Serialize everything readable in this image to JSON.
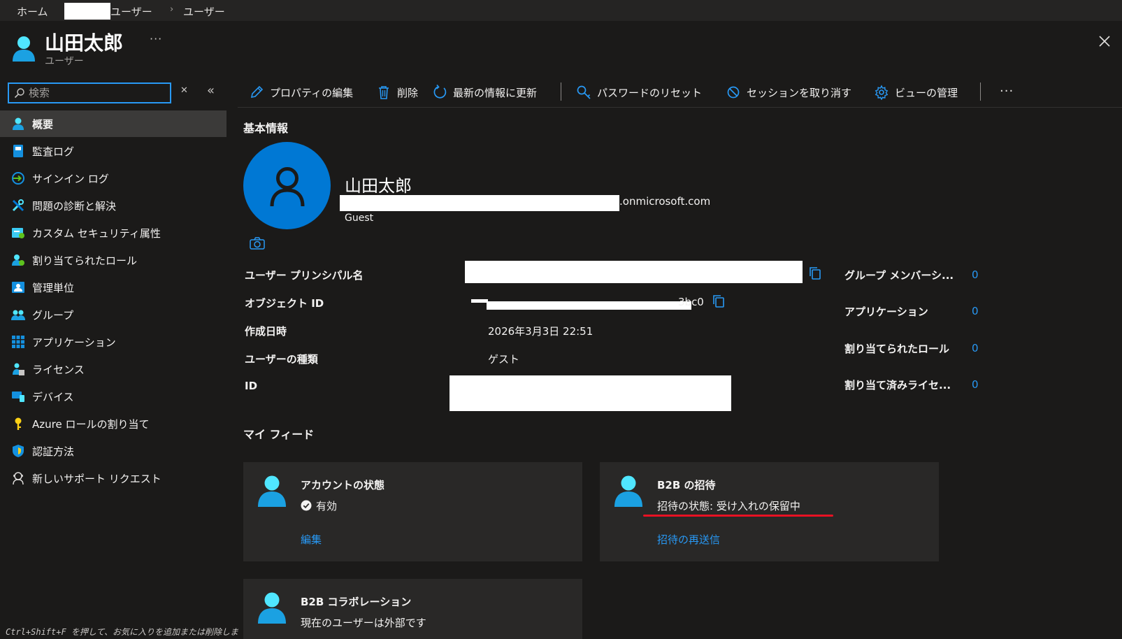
{
  "breadcrumb": {
    "home": "ホーム",
    "item_2": "ユーザー",
    "item_3": "ユーザー"
  },
  "header": {
    "title": "山田太郎",
    "subtitle": "ユーザー",
    "more": "···",
    "close": "✕"
  },
  "sidebar": {
    "search_placeholder": "検索",
    "clear": "✕",
    "collapse": "«",
    "items": [
      {
        "label": "概要",
        "icon": "user-icon",
        "active": true
      },
      {
        "label": "監査ログ",
        "icon": "audit-log-icon"
      },
      {
        "label": "サインイン ログ",
        "icon": "sign-in-icon"
      },
      {
        "label": "問題の診断と解決",
        "icon": "tools-icon"
      },
      {
        "label": "カスタム セキュリティ属性",
        "icon": "security-attributes-icon"
      },
      {
        "label": "割り当てられたロール",
        "icon": "roles-icon"
      },
      {
        "label": "管理単位",
        "icon": "admin-units-icon"
      },
      {
        "label": "グループ",
        "icon": "group-icon"
      },
      {
        "label": "アプリケーション",
        "icon": "applications-icon"
      },
      {
        "label": "ライセンス",
        "icon": "license-icon"
      },
      {
        "label": "デバイス",
        "icon": "devices-icon"
      },
      {
        "label": "Azure ロールの割り当て",
        "icon": "key-icon"
      },
      {
        "label": "認証方法",
        "icon": "shield-icon"
      },
      {
        "label": "新しいサポート リクエスト",
        "icon": "support-icon"
      }
    ],
    "shortcut_hint": "Ctrl+Shift+F を押して、お気に入りを追加または削除しま"
  },
  "toolbar": {
    "edit_properties": "プロパティの編集",
    "delete": "削除",
    "refresh": "最新の情報に更新",
    "reset_password": "パスワードのリセット",
    "revoke_sessions": "セッションを取り消す",
    "manage_view": "ビューの管理",
    "more": "···"
  },
  "basic_info": {
    "section_title": "基本情報",
    "display_name": "山田太郎",
    "email_suffix": ".onmicrosoft.com",
    "user_type_badge": "Guest"
  },
  "properties": {
    "upn_label": "ユーザー プリンシパル名",
    "object_id_label": "オブジェクト ID",
    "object_id_tail": "3bc0",
    "created_label": "作成日時",
    "created_value": "2026年3月3日 22:51",
    "user_type_label": "ユーザーの種類",
    "user_type_value": "ゲスト",
    "id_label": "ID"
  },
  "summary": [
    {
      "label": "グループ メンバーシ...",
      "count": "0"
    },
    {
      "label": "アプリケーション",
      "count": "0"
    },
    {
      "label": "割り当てられたロール",
      "count": "0"
    },
    {
      "label": "割り当て済みライセ...",
      "count": "0"
    }
  ],
  "my_feed": {
    "section_title": "マイ フィード",
    "account_status": {
      "title": "アカウントの状態",
      "status": "有効",
      "link": "編集"
    },
    "b2b_invite": {
      "title": "B2B の招待",
      "status": "招待の状態: 受け入れの保留中",
      "link": "招待の再送信"
    },
    "b2b_collab": {
      "title": "B2B コラボレーション",
      "status": "現在のユーザーは外部です"
    }
  },
  "colors": {
    "accent": "#2899f5",
    "avatar_bg": "#0078d4",
    "highlight_underline": "#e81123"
  }
}
